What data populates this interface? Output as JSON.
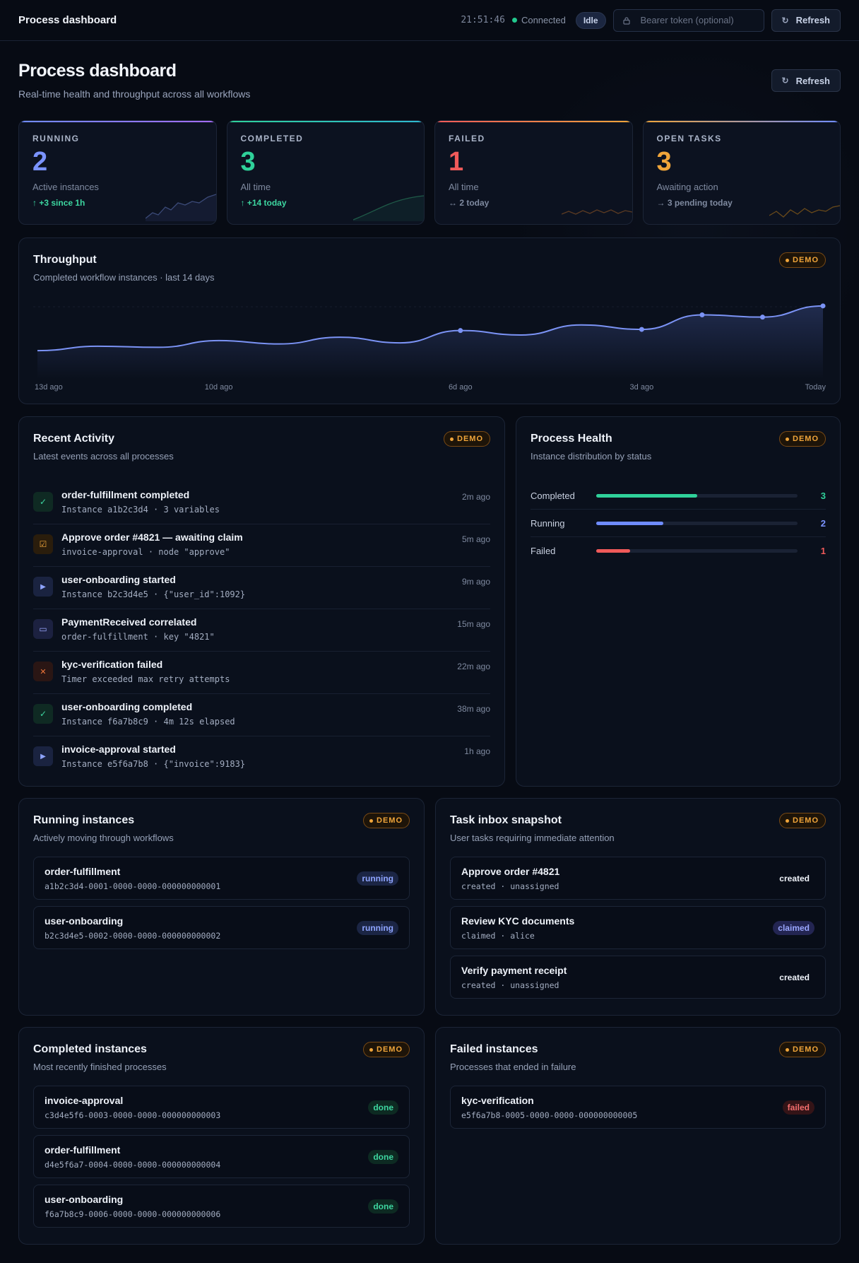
{
  "topbar": {
    "brand": "Process dashboard",
    "clock": "21:51:46",
    "connection": "Connected",
    "state": "Idle",
    "token_placeholder": "Bearer token (optional)",
    "refresh": "Refresh"
  },
  "header": {
    "title": "Process dashboard",
    "subtitle": "Real-time health and throughput across all workflows",
    "refresh": "Refresh"
  },
  "stats": [
    {
      "label": "RUNNING",
      "value": "2",
      "desc": "Active instances",
      "delta": "↑ +3 since 1h",
      "color": "#6f8cff",
      "delta_color": "#3dd6a0"
    },
    {
      "label": "COMPLETED",
      "value": "3",
      "desc": "All time",
      "delta": "↑ +14 today",
      "color": "#2fd19a",
      "delta_color": "#3dd6a0"
    },
    {
      "label": "FAILED",
      "value": "1",
      "desc": "All time",
      "delta": "↔ 2 today",
      "color": "#f05a5a",
      "delta_color": "#7f8aa0"
    },
    {
      "label": "OPEN TASKS",
      "value": "3",
      "desc": "Awaiting action",
      "delta": "→ 3 pending today",
      "color": "#f0a53a",
      "delta_color": "#7f8aa0"
    }
  ],
  "demo_badge": "DEMO",
  "throughput": {
    "title": "Throughput",
    "subtitle": "Completed workflow instances · last 14 days"
  },
  "chart_data": {
    "type": "area",
    "x": [
      "13d ago",
      "12d ago",
      "11d ago",
      "10d ago",
      "9d ago",
      "8d ago",
      "7d ago",
      "6d ago",
      "5d ago",
      "4d ago",
      "3d ago",
      "2d ago",
      "1d ago",
      "Today"
    ],
    "tick_labels": [
      "13d ago",
      "10d ago",
      "6d ago",
      "3d ago",
      "Today"
    ],
    "values": [
      10,
      14,
      13,
      19,
      16,
      22,
      17,
      28,
      24,
      33,
      29,
      42,
      40,
      50
    ],
    "highlighted_points": [
      7,
      10,
      11,
      12,
      13
    ],
    "ylim": [
      0,
      60
    ],
    "grid": false,
    "color": "#7b93f5"
  },
  "activity": {
    "title": "Recent Activity",
    "subtitle": "Latest events across all processes",
    "items": [
      {
        "icon": "check-icon",
        "glyph": "✓",
        "title": "order-fulfillment completed",
        "detail": "Instance a1b2c3d4 · 3 variables",
        "ago": "2m ago",
        "bg": "#0f2a23",
        "fg": "#3dd6a0"
      },
      {
        "icon": "task-icon",
        "glyph": "☑",
        "title": "Approve order #4821 — awaiting claim",
        "detail": "invoice-approval · node \"approve\"",
        "ago": "5m ago",
        "bg": "#2a1d0c",
        "fg": "#f0a53a"
      },
      {
        "icon": "play-icon",
        "glyph": "▶",
        "title": "user-onboarding started",
        "detail": "Instance b2c3d4e5 · {\"user_id\":1092}",
        "ago": "9m ago",
        "bg": "#1a2340",
        "fg": "#8ea4ff"
      },
      {
        "icon": "message-icon",
        "glyph": "▭",
        "title": "PaymentReceived correlated",
        "detail": "order-fulfillment · key \"4821\"",
        "ago": "15m ago",
        "bg": "#1c2140",
        "fg": "#9aa6ff"
      },
      {
        "icon": "close-icon",
        "glyph": "✕",
        "title": "kyc-verification failed",
        "detail": "Timer exceeded max retry attempts",
        "ago": "22m ago",
        "bg": "#2a1614",
        "fg": "#f0763a"
      },
      {
        "icon": "check-icon",
        "glyph": "✓",
        "title": "user-onboarding completed",
        "detail": "Instance f6a7b8c9 · 4m 12s elapsed",
        "ago": "38m ago",
        "bg": "#0f2a23",
        "fg": "#3dd6a0"
      },
      {
        "icon": "play-icon",
        "glyph": "▶",
        "title": "invoice-approval started",
        "detail": "Instance e5f6a7b8 · {\"invoice\":9183}",
        "ago": "1h ago",
        "bg": "#1a2340",
        "fg": "#8ea4ff"
      }
    ]
  },
  "health": {
    "title": "Process Health",
    "subtitle": "Instance distribution by status",
    "rows": [
      {
        "name": "Completed",
        "value": "3",
        "fraction": 0.5,
        "color": "#2fd19a"
      },
      {
        "name": "Running",
        "value": "2",
        "fraction": 0.333,
        "color": "#6f8cff"
      },
      {
        "name": "Failed",
        "value": "1",
        "fraction": 0.167,
        "color": "#f05a5a"
      }
    ]
  },
  "running": {
    "title": "Running instances",
    "subtitle": "Actively moving through workflows",
    "items": [
      {
        "name": "order-fulfillment",
        "id": "a1b2c3d4-0001-0000-0000-000000000001",
        "status": "running"
      },
      {
        "name": "user-onboarding",
        "id": "b2c3d4e5-0002-0000-0000-000000000002",
        "status": "running"
      }
    ]
  },
  "tasks": {
    "title": "Task inbox snapshot",
    "subtitle": "User tasks requiring immediate attention",
    "items": [
      {
        "name": "Approve order #4821",
        "id": "created · unassigned",
        "status": "created"
      },
      {
        "name": "Review KYC documents",
        "id": "claimed · alice",
        "status": "claimed"
      },
      {
        "name": "Verify payment receipt",
        "id": "created · unassigned",
        "status": "created"
      }
    ]
  },
  "completed": {
    "title": "Completed instances",
    "subtitle": "Most recently finished processes",
    "items": [
      {
        "name": "invoice-approval",
        "id": "c3d4e5f6-0003-0000-0000-000000000003",
        "status": "done"
      },
      {
        "name": "order-fulfillment",
        "id": "d4e5f6a7-0004-0000-0000-000000000004",
        "status": "done"
      },
      {
        "name": "user-onboarding",
        "id": "f6a7b8c9-0006-0000-0000-000000000006",
        "status": "done"
      }
    ]
  },
  "failed": {
    "title": "Failed instances",
    "subtitle": "Processes that ended in failure",
    "items": [
      {
        "name": "kyc-verification",
        "id": "e5f6a7b8-0005-0000-0000-000000000005",
        "status": "failed"
      }
    ]
  }
}
